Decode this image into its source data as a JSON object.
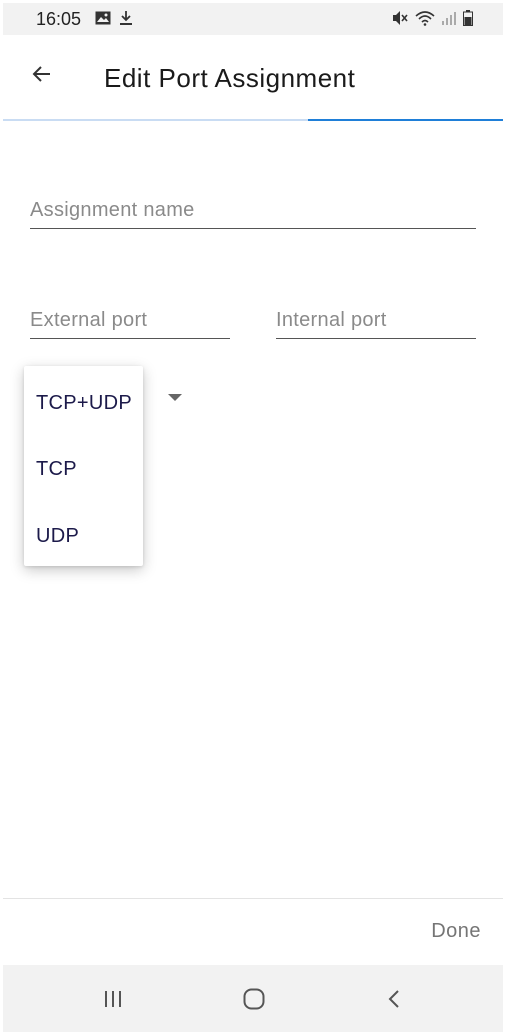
{
  "status_bar": {
    "time": "16:05",
    "left_icons": [
      "image-icon",
      "download-icon"
    ],
    "right_icons": [
      "mute-icon",
      "wifi-icon",
      "signal-icon",
      "battery-icon"
    ]
  },
  "app_bar": {
    "title": "Edit Port Assignment",
    "back_icon": "arrow-back-icon",
    "progress": 0.39
  },
  "form": {
    "assignment_name": {
      "value": "",
      "placeholder": "Assignment name"
    },
    "external_port": {
      "value": "",
      "placeholder": "External port"
    },
    "internal_port": {
      "value": "",
      "placeholder": "Internal port"
    },
    "protocol": {
      "options": [
        "TCP+UDP",
        "TCP",
        "UDP"
      ]
    }
  },
  "footer": {
    "done_label": "Done"
  },
  "nav_bar": {
    "buttons": [
      "recents-icon",
      "home-icon",
      "back-icon"
    ]
  },
  "colors": {
    "accent": "#1f7fd8",
    "progress_track": "#c9dcf3",
    "menu_text": "#1c1a4a",
    "done_text": "#757575"
  }
}
